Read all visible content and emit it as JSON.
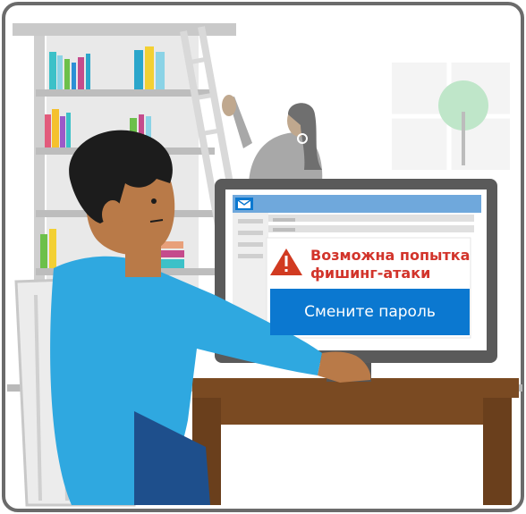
{
  "alert": {
    "title_line1": "Возможна попытка",
    "title_line2": "фишинг-атаки",
    "button_label": "Смените пароль"
  },
  "icons": [
    "envelope-icon",
    "warning-icon"
  ],
  "colors": {
    "frame": "#6b6b6b",
    "browser_bar": "#6fa8dc",
    "alert_text": "#d2342b",
    "warning_icon": "#d13a21",
    "button": "#0b78d0"
  }
}
